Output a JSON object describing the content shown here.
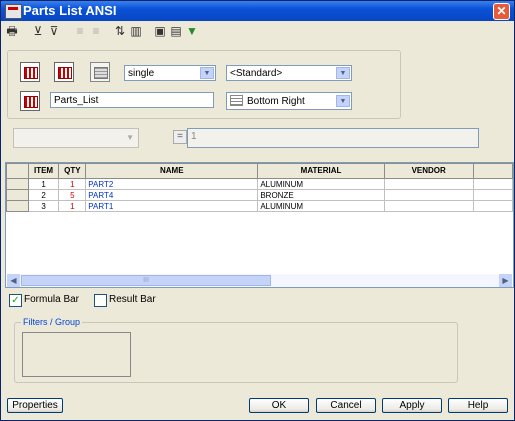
{
  "window": {
    "title": "Parts List ANSI"
  },
  "toolbar": {
    "icons": [
      "printer-icon",
      "column-chooser-icon",
      "column-arrange-icon",
      "ungroup-icon",
      "regroup-icon",
      "sort-icon",
      "columns-icon",
      "save-icon",
      "load-icon",
      "filter-icon"
    ]
  },
  "settings": {
    "mode_value": "single",
    "standard_value": "<Standard>",
    "table_name": "Parts_List",
    "anchor_value": "Bottom Right"
  },
  "formula": {
    "value": "1"
  },
  "grid": {
    "columns": [
      "ITEM",
      "QTY",
      "NAME",
      "MATERIAL",
      "VENDOR"
    ],
    "rows": [
      {
        "item": "1",
        "qty": "1",
        "name": "PART2",
        "material": "ALUMINUM",
        "vendor": ""
      },
      {
        "item": "2",
        "qty": "5",
        "name": "PART4",
        "material": "BRONZE",
        "vendor": ""
      },
      {
        "item": "3",
        "qty": "1",
        "name": "PART1",
        "material": "ALUMINUM",
        "vendor": ""
      }
    ],
    "scroll_thumb": "III"
  },
  "options": {
    "formula_bar": {
      "label": "Formula Bar",
      "checked": true
    },
    "result_bar": {
      "label": "Result Bar",
      "checked": false
    }
  },
  "filters": {
    "legend": "Filters / Group"
  },
  "buttons": {
    "properties": "Properties",
    "ok": "OK",
    "cancel": "Cancel",
    "apply": "Apply",
    "help": "Help"
  },
  "colors": {
    "title_bar": "#0a52d6",
    "link_blue": "#0033cc",
    "qty_red": "#cc0000"
  }
}
